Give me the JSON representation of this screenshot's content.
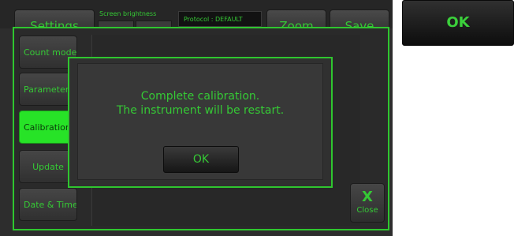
{
  "topbar": {
    "settings_label": "Settings",
    "brightness_label": "Screen brightness",
    "protocol_text": "Protocol : DEFAULT",
    "zoom_label": "Zoom",
    "save_label": "Save"
  },
  "sidebar": {
    "items": [
      {
        "label": "Count mode",
        "selected": false
      },
      {
        "label": "Parameters",
        "selected": false
      },
      {
        "label": "Calibration",
        "selected": true
      },
      {
        "label": "Update",
        "selected": false
      },
      {
        "label": "Date & Time",
        "selected": false
      }
    ]
  },
  "close": {
    "icon": "X",
    "label": "Close"
  },
  "dialog": {
    "line1": "Complete calibration.",
    "line2": "The instrument will be restart.",
    "ok_label": "OK"
  },
  "zoomed_button": {
    "label": "OK"
  },
  "colors": {
    "accent": "#2fc62f",
    "selected": "#27e327",
    "background": "#2d2d2d"
  }
}
